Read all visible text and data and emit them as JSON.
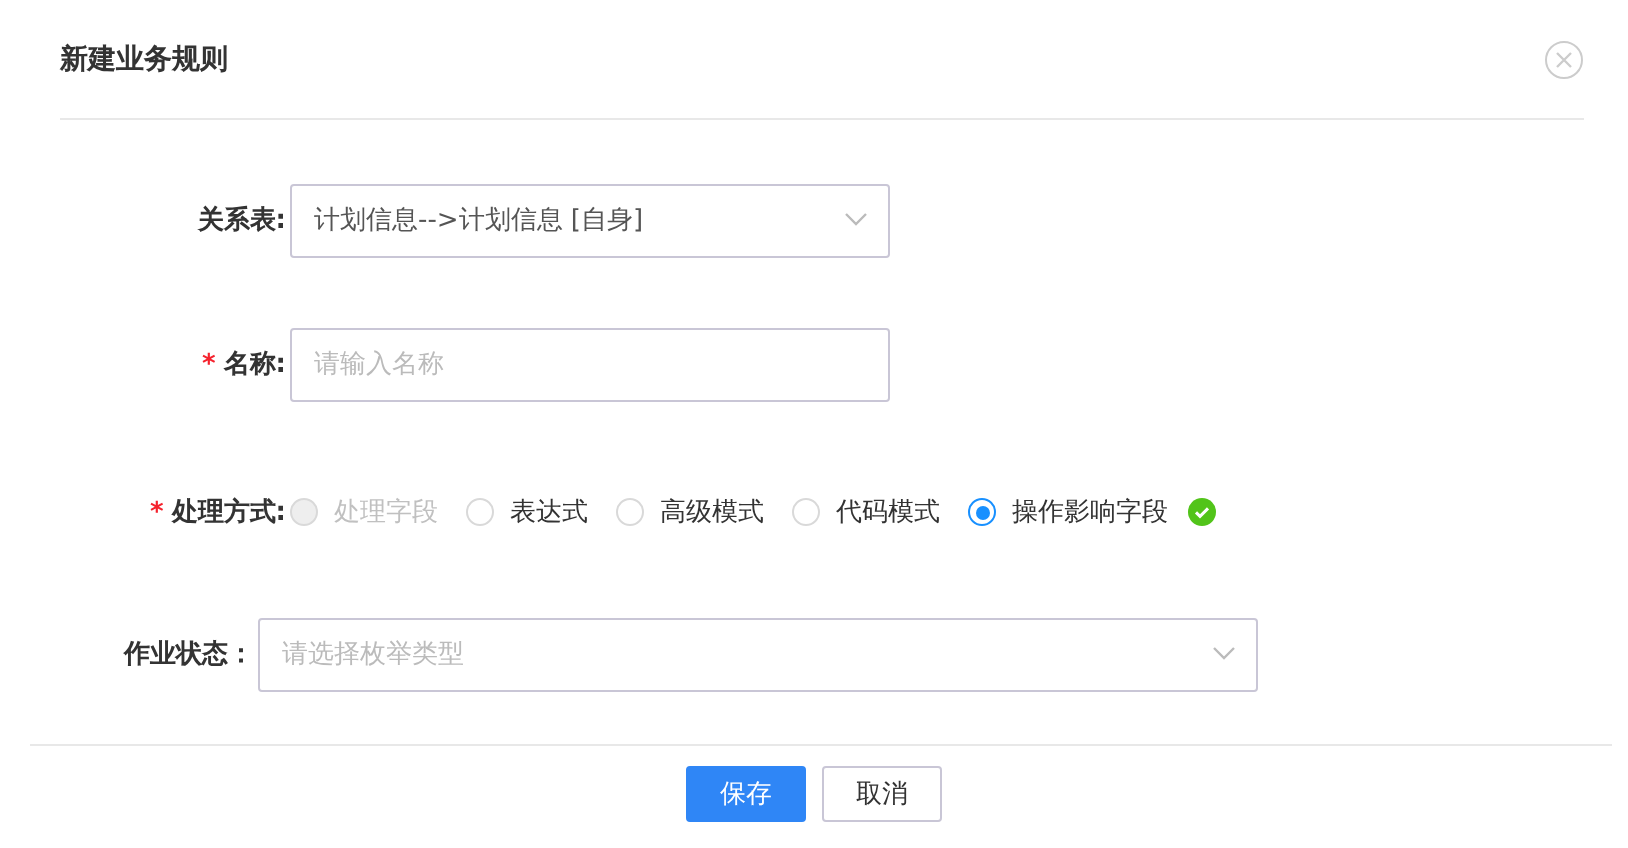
{
  "dialog": {
    "title": "新建业务规则"
  },
  "fields": [
    {
      "kind": "select",
      "label": "关系表:",
      "value": "计划信息-->计划信息 [自身]"
    },
    {
      "kind": "input",
      "label": "名称:",
      "required_mark": "*",
      "placeholder": "请输入名称"
    },
    {
      "kind": "radios",
      "label": "处理方式:",
      "required_mark": "*",
      "valid": true,
      "options": [
        {
          "label": "处理字段",
          "selected": false,
          "disabled": true
        },
        {
          "label": "表达式",
          "selected": false,
          "disabled": false
        },
        {
          "label": "高级模式",
          "selected": false,
          "disabled": false
        },
        {
          "label": "代码模式",
          "selected": false,
          "disabled": false
        },
        {
          "label": "操作影响字段",
          "selected": true,
          "disabled": false
        }
      ]
    },
    {
      "kind": "wide-select",
      "label": "作业状态：",
      "placeholder": "请选择枚举类型"
    }
  ],
  "buttons": [
    {
      "label": "保存",
      "kind": "primary"
    },
    {
      "label": "取消",
      "kind": "default"
    }
  ]
}
